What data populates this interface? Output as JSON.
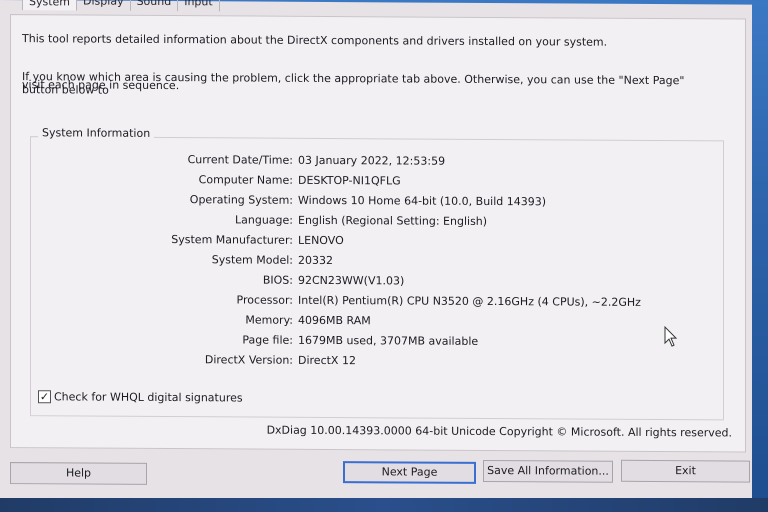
{
  "tabs": [
    "System",
    "Display",
    "Sound",
    "Input"
  ],
  "intro": {
    "line1": "This tool reports detailed information about the DirectX components and drivers installed on your system.",
    "line2": "If you know which area is causing the problem, click the appropriate tab above.  Otherwise, you can use the \"Next Page\" button below to",
    "line3": "visit each page in sequence."
  },
  "system_info": {
    "title": "System Information",
    "rows": [
      {
        "label": "Current Date/Time:",
        "value": "03 January 2022, 12:53:59"
      },
      {
        "label": "Computer Name:",
        "value": "DESKTOP-NI1QFLG"
      },
      {
        "label": "Operating System:",
        "value": "Windows 10 Home 64-bit (10.0, Build 14393)"
      },
      {
        "label": "Language:",
        "value": "English (Regional Setting: English)"
      },
      {
        "label": "System Manufacturer:",
        "value": "LENOVO"
      },
      {
        "label": "System Model:",
        "value": "20332"
      },
      {
        "label": "BIOS:",
        "value": "92CN23WW(V1.03)"
      },
      {
        "label": "Processor:",
        "value": "Intel(R) Pentium(R) CPU  N3520  @ 2.16GHz (4 CPUs), ~2.2GHz"
      },
      {
        "label": "Memory:",
        "value": "4096MB RAM"
      },
      {
        "label": "Page file:",
        "value": "1679MB used, 3707MB available"
      },
      {
        "label": "DirectX Version:",
        "value": "DirectX 12"
      }
    ]
  },
  "whql": {
    "label": "Check for WHQL digital signatures",
    "checked": true,
    "mark": "✓"
  },
  "footer_text": "DxDiag 10.00.14393.0000 64-bit Unicode  Copyright © Microsoft. All rights reserved.",
  "buttons": {
    "help": "Help",
    "next_page": "Next Page",
    "save_all": "Save All Information...",
    "exit": "Exit"
  },
  "colors": {
    "window_bg": "#e6e2e6",
    "default_button_border": "#3a6fd1"
  }
}
